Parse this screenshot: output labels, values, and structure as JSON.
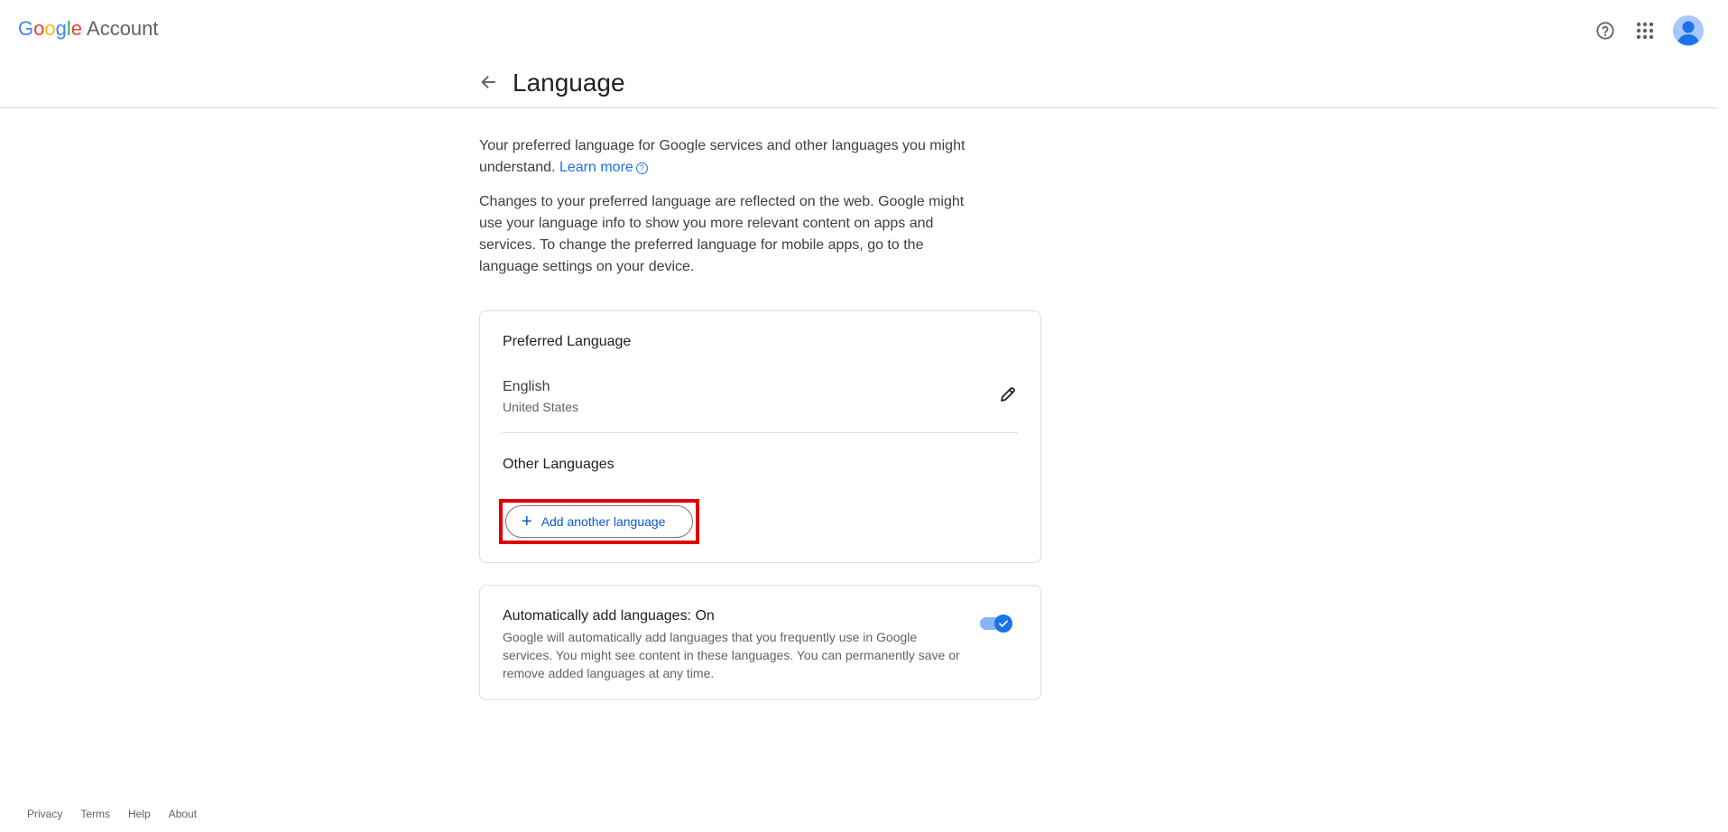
{
  "header": {
    "logo_letters": [
      "G",
      "o",
      "o",
      "g",
      "l",
      "e"
    ],
    "product_name": "Account",
    "icons": [
      "help-icon",
      "apps-icon",
      "avatar-icon"
    ]
  },
  "title_bar": {
    "back_icon": "arrow-left-icon",
    "title": "Language"
  },
  "intro": {
    "paragraph1": "Your preferred language for Google services and other languages you might understand.",
    "learn_more": "Learn more",
    "learn_more_icon": "help-circle-icon",
    "paragraph2": "Changes to your preferred language are reflected on the web. Google might use your language info to show you more relevant content on apps and services. To change the preferred language for mobile apps, go to the language settings on your device."
  },
  "preferred_card": {
    "title": "Preferred Language",
    "language": "English",
    "region": "United States",
    "edit_icon": "pencil-icon",
    "other_title": "Other Languages",
    "add_button": "Add another language",
    "add_icon": "plus-icon"
  },
  "auto_card": {
    "title": "Automatically add languages: On",
    "description": "Google will automatically add languages that you frequently use in Google services. You might see content in these languages. You can permanently save or remove added languages at any time.",
    "toggle_on": true
  },
  "footer": {
    "links": [
      "Privacy",
      "Terms",
      "Help",
      "About"
    ]
  },
  "colors": {
    "accent": "#1a73e8",
    "highlight_box": "#e00000",
    "divider": "#dadce0"
  }
}
